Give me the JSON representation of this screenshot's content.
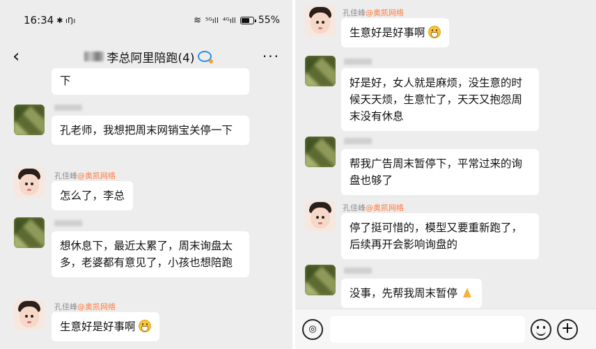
{
  "status": {
    "time": "16:34",
    "bt_icons": "✱ ıŊı",
    "signal_5g": "⁵ᴳıll",
    "signal_4g": "⁴ᴳıll",
    "battery": "55%"
  },
  "header": {
    "back": "‹",
    "title": "李总阿里陪跑(4)",
    "more": "···"
  },
  "left_messages": [
    {
      "text": "下"
    },
    {
      "text": "孔老师，我想把周末网销宝关停一下"
    },
    {
      "sender": "孔佳峰",
      "org": "@奥凯网络",
      "text": "怎么了，李总"
    },
    {
      "text": "想休息下，最近太累了，周末询盘太多，老婆都有意见了，小孩也想陪跑"
    },
    {
      "sender": "孔佳峰",
      "org": "@奥凯网络",
      "text": "生意好是好事啊"
    }
  ],
  "right_messages": [
    {
      "sender": "孔佳峰",
      "org": "@奥凯网络",
      "text": "生意好是好事啊"
    },
    {
      "text": "好是好，女人就是麻烦，没生意的时候天天烦，生意忙了，天天又抱怨周末没有休息"
    },
    {
      "text": "帮我广告周末暂停下，平常过来的询盘也够了"
    },
    {
      "sender": "孔佳峰",
      "org": "@奥凯网络",
      "text": "停了挺可惜的，模型又要重新跑了，后续再开会影响询盘的"
    },
    {
      "text": "没事，先帮我周末暂停"
    }
  ],
  "colors": {
    "background": "#ededed",
    "bubble": "#ffffff",
    "org_tag": "#ff7a3d",
    "chat_icon": "#2b8ce8"
  },
  "icons": [
    "back-icon",
    "chat-group-icon",
    "more-icon",
    "voice-icon",
    "emoji-icon",
    "plus-icon",
    "grin-emoji",
    "pray-emoji"
  ]
}
